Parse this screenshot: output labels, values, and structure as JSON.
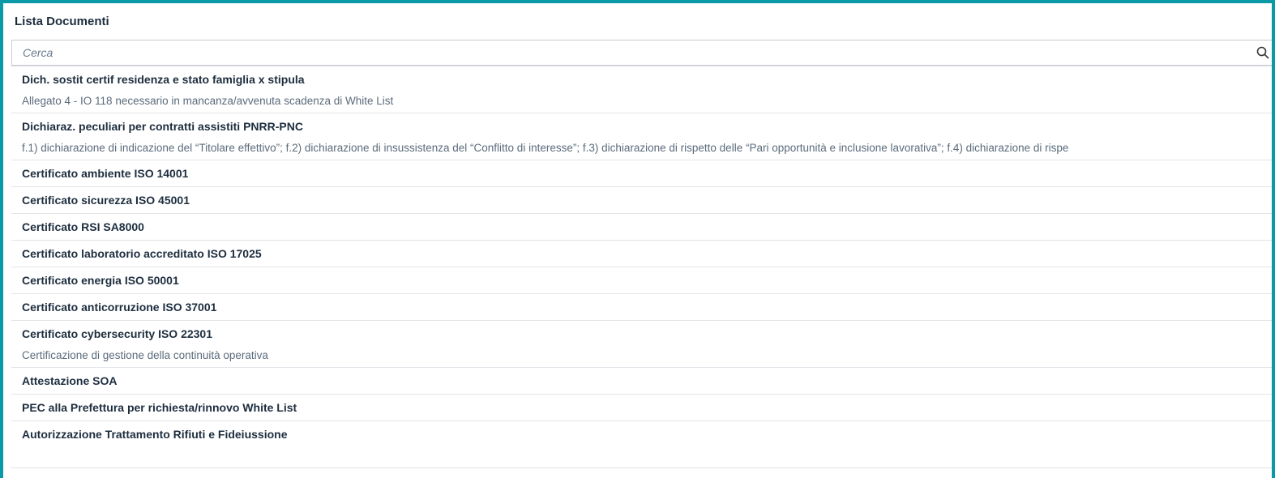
{
  "header": {
    "title": "Lista Documenti"
  },
  "search": {
    "placeholder": "Cerca"
  },
  "documents": [
    {
      "title": "Dich. sostit certif residenza e stato famiglia x stipula",
      "description": "Allegato 4 - IO 118 necessario in mancanza/avvenuta scadenza di White List"
    },
    {
      "title": "Dichiaraz. peculiari per contratti assistiti PNRR-PNC",
      "description": "f.1) dichiarazione di indicazione del “Titolare effettivo”; f.2) dichiarazione di insussistenza del “Conflitto di interesse”; f.3) dichiarazione di rispetto delle “Pari opportunità e inclusione lavorativa”; f.4) dichiarazione di rispe"
    },
    {
      "title": "Certificato ambiente ISO 14001"
    },
    {
      "title": "Certificato sicurezza ISO 45001"
    },
    {
      "title": "Certificato RSI SA8000"
    },
    {
      "title": "Certificato laboratorio accreditato ISO 17025"
    },
    {
      "title": "Certificato energia ISO 50001"
    },
    {
      "title": "Certificato anticorruzione ISO 37001"
    },
    {
      "title": "Certificato cybersecurity ISO 22301",
      "description": "Certificazione di gestione della continuità operativa"
    },
    {
      "title": "Attestazione SOA"
    },
    {
      "title": "PEC alla Prefettura per richiesta/rinnovo White List"
    },
    {
      "title": "Autorizzazione Trattamento Rifiuti e Fideiussione"
    }
  ],
  "colors": {
    "frame": "#0a9aa6",
    "text": "#1d2d3e",
    "muted": "#5b6b7b"
  },
  "icons": {
    "search": "search-icon"
  }
}
